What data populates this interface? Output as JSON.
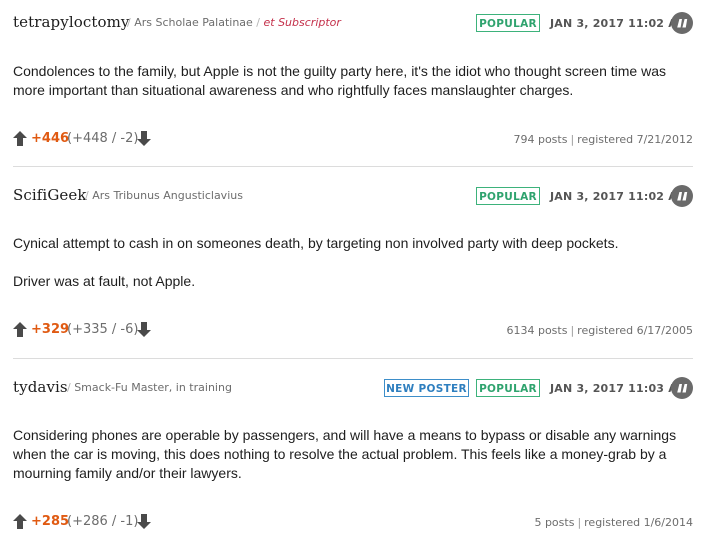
{
  "comments": [
    {
      "username": "tetrapyloctomy",
      "title": "Ars Scholae Palatinae",
      "subscriptor": "et Subscriptor",
      "badges": [
        "POPULAR"
      ],
      "timestamp": "JAN 3, 2017 11:02 AM",
      "paragraphs": [
        "Condolences to the family, but Apple is not the guilty party here, it's the idiot who thought screen time was more important than situational awareness and who rightfully faces manslaughter charges."
      ],
      "score": "+446",
      "score_detail": "(+448 / -2)",
      "posts": "794 posts",
      "registered": "registered 7/21/2012"
    },
    {
      "username": "ScifiGeek",
      "title": "Ars Tribunus Angusticlavius",
      "badges": [
        "POPULAR"
      ],
      "timestamp": "JAN 3, 2017 11:02 AM",
      "paragraphs": [
        "Cynical attempt to cash in on someones death, by targeting non involved party with deep pockets.",
        "Driver was at fault, not Apple."
      ],
      "score": "+329",
      "score_detail": "(+335 / -6)",
      "posts": "6134 posts",
      "registered": "registered 6/17/2005"
    },
    {
      "username": "tydavis",
      "title": "Smack-Fu Master, in training",
      "badges": [
        "NEW POSTER",
        "POPULAR"
      ],
      "timestamp": "JAN 3, 2017 11:03 AM",
      "paragraphs": [
        "Considering phones are operable by passengers, and will have a means to bypass or disable any warnings when the car is moving, this does nothing to resolve the actual problem. This feels like a money-grab by a mourning family and/or their lawyers."
      ],
      "score": "+285",
      "score_detail": "(+286 / -1)",
      "posts": "5 posts",
      "registered": "registered 1/6/2014"
    }
  ],
  "icons": {
    "quote": "quote-icon",
    "upvote": "arrow-up-icon",
    "downvote": "arrow-down-icon"
  },
  "colors": {
    "score": "#e05a12",
    "popular_badge": "#2fa36e",
    "new_poster_badge": "#2f7fbf",
    "subscriptor": "#c4314b"
  }
}
